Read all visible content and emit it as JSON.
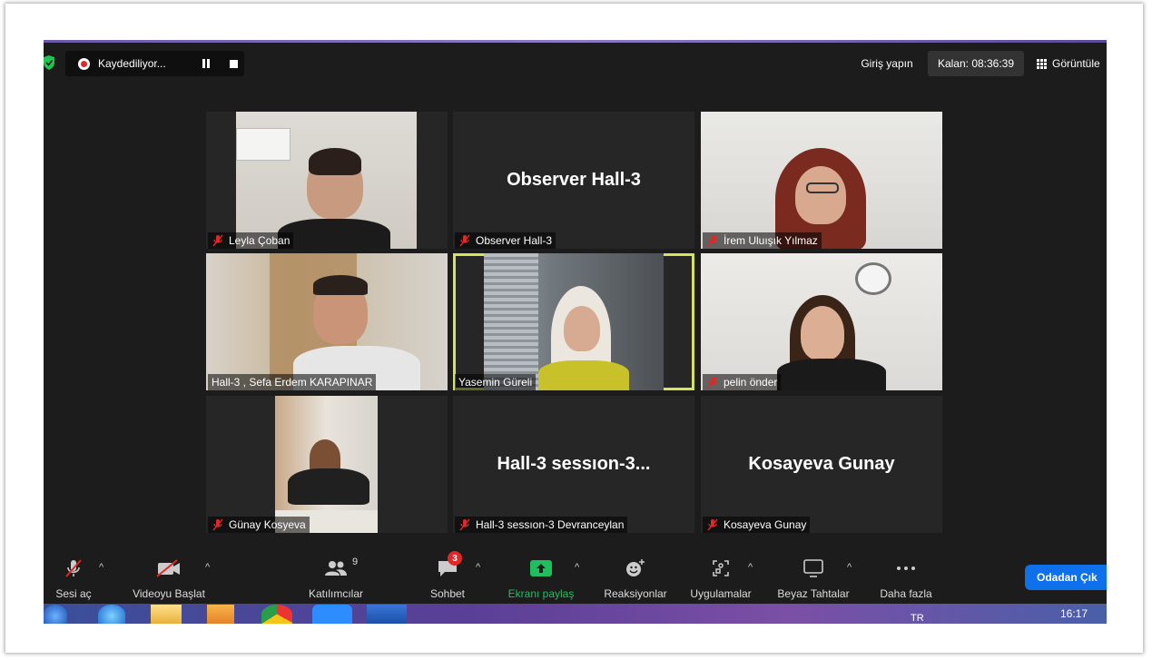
{
  "topbar": {
    "recording_label": "Kaydediliyor...",
    "signin_label": "Giriş yapın",
    "timer_label": "Kalan: 08:36:39",
    "view_label": "Görüntüle"
  },
  "tiles": [
    {
      "name": "Leyla Çoban",
      "muted": true,
      "has_video": true
    },
    {
      "name": "Observer Hall-3",
      "muted": true,
      "has_video": false,
      "display": "Observer Hall-3"
    },
    {
      "name": "İrem Uluışık Yılmaz",
      "muted": true,
      "has_video": true
    },
    {
      "name": "Hall-3 , Sefa Erdem KARAPINAR",
      "muted": false,
      "has_video": true
    },
    {
      "name": "Yasemin Güreli",
      "muted": false,
      "has_video": true,
      "speaking": true
    },
    {
      "name": "pelin önder",
      "muted": true,
      "has_video": true
    },
    {
      "name": "Günay Kosyeva",
      "muted": true,
      "has_video": true
    },
    {
      "name": "Hall-3 sessıon-3 Devranceylan",
      "muted": true,
      "has_video": false,
      "display": "Hall-3  sessıon-3..."
    },
    {
      "name": "Kosayeva Gunay",
      "muted": true,
      "has_video": false,
      "display": "Kosayeva Gunay"
    }
  ],
  "toolbar": {
    "unmute_label": "Sesi aç",
    "video_label": "Videoyu Başlat",
    "participants_label": "Katılımcılar",
    "participants_count": "9",
    "chat_label": "Sohbet",
    "chat_badge": "3",
    "share_label": "Ekranı paylaş",
    "reactions_label": "Reaksiyonlar",
    "apps_label": "Uygulamalar",
    "whiteboard_label": "Beyaz Tahtalar",
    "more_label": "Daha fazla",
    "leave_label": "Odadan Çık"
  },
  "taskbar": {
    "lang": "TR",
    "time": "16:17"
  },
  "colors": {
    "accent_share": "#1fbf5f",
    "leave_button": "#0e71eb",
    "speaking_border": "#d8e35c",
    "muted_icon": "#e02828"
  }
}
